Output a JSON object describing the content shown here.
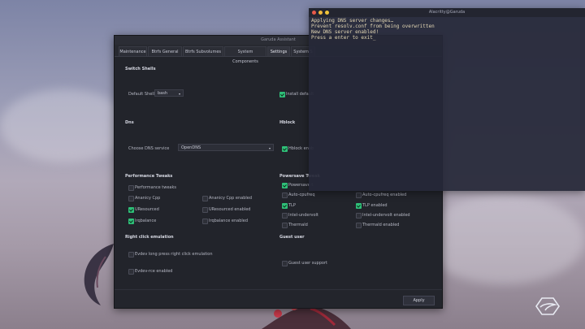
{
  "colors": {
    "accent": "#2fbf78",
    "terminal_text": "#e3d7b4",
    "close": "#e8594a",
    "min": "#f2b93b",
    "max": "#f0c43a"
  },
  "garuda": {
    "title": "Garuda Assistant",
    "tabs": [
      "Maintenance",
      "Btrfs General",
      "Btrfs Subvolumes",
      "System Components",
      "Settings",
      "System S"
    ],
    "active_tab": "Settings",
    "switch_shells": {
      "heading": "Switch Shells",
      "default_shell_label": "Default Shell:",
      "default_shell_value": "bash",
      "install_default": "Install default"
    },
    "dns": {
      "heading": "Dns",
      "choose_label": "Choose DNS service",
      "choose_value": "OpenDNS"
    },
    "hblock": {
      "heading": "Hblock",
      "enabled_label": "Hblock enab"
    },
    "performance": {
      "heading": "Performance Tweaks",
      "items": [
        {
          "label": "Performance tweaks",
          "checked": false
        },
        {
          "label": "Ananicy Cpp",
          "checked": false
        },
        {
          "label": "Ananicy Cpp enabled",
          "checked": false
        },
        {
          "label": "UResourced",
          "checked": true
        },
        {
          "label": "UResourced enabled",
          "checked": false
        },
        {
          "label": "Irqbalance",
          "checked": true
        },
        {
          "label": "Irqbalance enabled",
          "checked": false
        }
      ]
    },
    "powersave": {
      "heading": "Powersave Tweak",
      "items": [
        {
          "label": "Powersave t",
          "checked": true
        },
        {
          "label": "Auto-cpufreq",
          "checked": false
        },
        {
          "label": "Auto-cpufreq enabled",
          "checked": false
        },
        {
          "label": "TLP",
          "checked": true
        },
        {
          "label": "TLP enabled",
          "checked": true
        },
        {
          "label": "Intel-undervolt",
          "checked": false
        },
        {
          "label": "Intel-undervolt enabled",
          "checked": false
        },
        {
          "label": "Thermald",
          "checked": false
        },
        {
          "label": "Thermald enabled",
          "checked": false
        }
      ]
    },
    "rightclick": {
      "heading": "Right click emulation",
      "items": [
        {
          "label": "Evdev long press right click emulation",
          "checked": false
        },
        {
          "label": "Evdev-rce enabled",
          "checked": false
        }
      ]
    },
    "guest": {
      "heading": "Guest user",
      "items": [
        {
          "label": "Guest user support",
          "checked": false
        }
      ]
    },
    "apply_label": "Apply"
  },
  "terminal": {
    "title": "Alacritty@Garuda",
    "lines": [
      "Applying DNS server changes…",
      "Prevent resolv.conf from being overwritten",
      "New DNS server enabled!",
      "Press a enter to exit_"
    ]
  },
  "icons": {
    "desktop_logo": "garuda-logo-icon"
  }
}
